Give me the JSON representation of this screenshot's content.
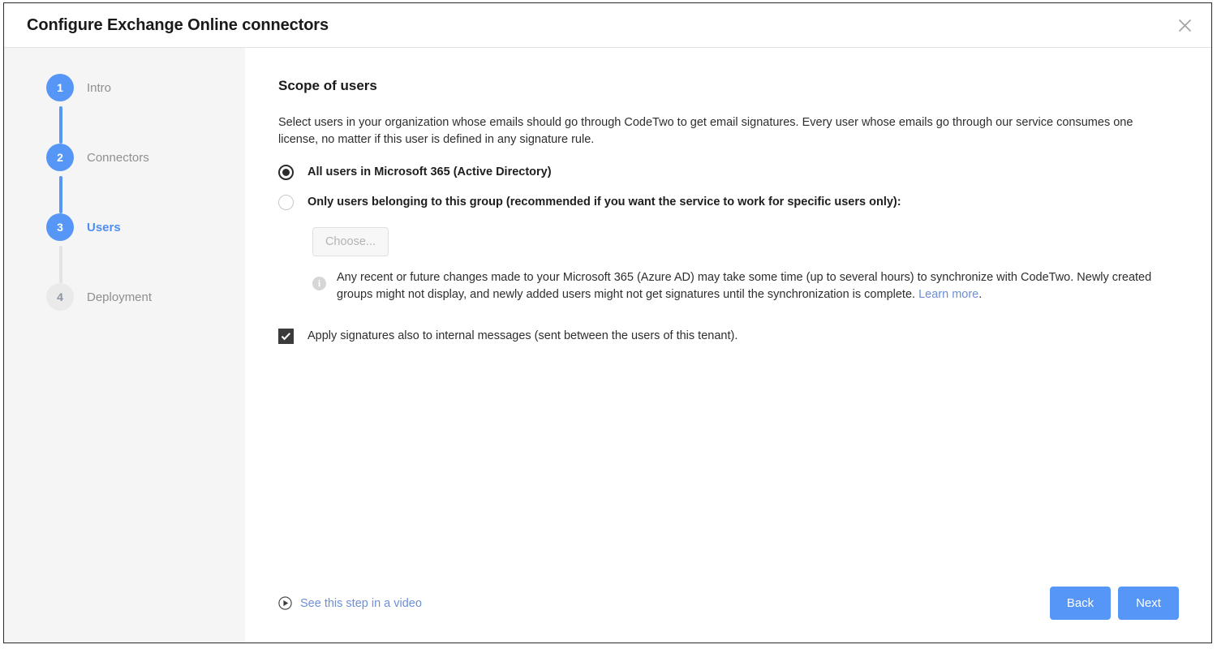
{
  "window": {
    "title": "Configure Exchange Online connectors",
    "close_icon": "close-icon"
  },
  "colors": {
    "accent_blue": "#5596f6",
    "link_blue": "#6c8fd8",
    "current_step_label": "#4f8ff5",
    "sidebar_bg": "#f5f5f5",
    "pending_step_bg": "#eaeaea",
    "checkbox_fill": "#3b3b3b"
  },
  "sidebar": {
    "steps": [
      {
        "number": "1",
        "label": "Intro",
        "state": "done"
      },
      {
        "number": "2",
        "label": "Connectors",
        "state": "done"
      },
      {
        "number": "3",
        "label": "Users",
        "state": "current"
      },
      {
        "number": "4",
        "label": "Deployment",
        "state": "pending"
      }
    ]
  },
  "main": {
    "title": "Scope of users",
    "description": "Select users in your organization whose emails should go through CodeTwo to get email signatures. Every user whose emails go through our service consumes one license, no matter if this user is defined in any signature rule.",
    "options": [
      {
        "label": "All users in Microsoft 365 (Active Directory)",
        "selected": true
      },
      {
        "label": "Only users belonging to this group (recommended if you want the service to work for specific users only):",
        "selected": false
      }
    ],
    "choose_button": {
      "label": "Choose...",
      "disabled": true
    },
    "info_note": {
      "icon": "info-icon",
      "text": "Any recent or future changes made to your Microsoft 365 (Azure AD) may take some time (up to several hours) to synchronize with CodeTwo. Newly created groups might not display, and newly added users might not get signatures until the synchronization is complete. ",
      "link_text": "Learn more",
      "text_after_link": "."
    },
    "checkbox": {
      "label": "Apply signatures also to internal messages (sent between the users of this tenant).",
      "checked": true
    }
  },
  "footer": {
    "video_link": {
      "icon": "play-circle-icon",
      "label": "See this step in a video"
    },
    "back_label": "Back",
    "next_label": "Next"
  }
}
